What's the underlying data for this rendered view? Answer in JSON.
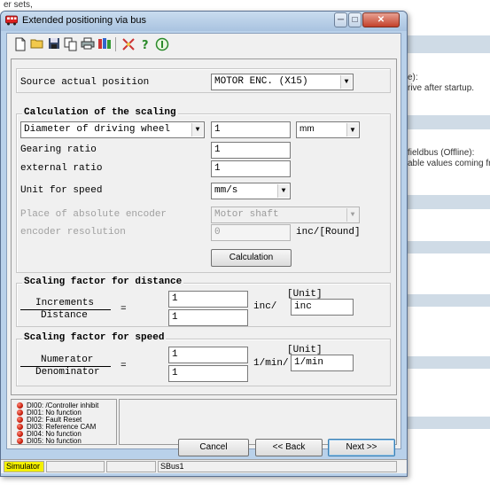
{
  "background": {
    "top_text": "er sets,",
    "side_lines": [
      "e):",
      "rive after startup.",
      "fieldbus (Offline):",
      "able values coming fr"
    ]
  },
  "window": {
    "title": "Extended positioning via bus",
    "min_glyph": "─",
    "max_glyph": "□",
    "close_glyph": "✕"
  },
  "toolbar": {
    "icons": [
      "new-document-icon",
      "open-folder-icon",
      "save-disk-icon",
      "copy-documents-icon",
      "print-icon",
      "books-icon",
      "tools-icon",
      "help-icon",
      "info-icon"
    ]
  },
  "source": {
    "label": "Source actual position",
    "value": "MOTOR ENC. (X15)"
  },
  "scaling": {
    "title": "Calculation of the scaling",
    "diameter_select": "Diameter of driving wheel",
    "diameter_value": "1",
    "diameter_unit": "mm",
    "gearing_label": "Gearing ratio",
    "gearing_value": "1",
    "external_label": "external ratio",
    "external_value": "1",
    "speed_unit_label": "Unit for speed",
    "speed_unit_value": "mm/s",
    "abs_encoder_label": "Place of absolute encoder",
    "abs_encoder_value": "Motor shaft",
    "encoder_res_label": "encoder resolution",
    "encoder_res_value": "0",
    "encoder_res_unit": "inc/[Round]",
    "calc_button": "Calculation"
  },
  "distance": {
    "title": "Scaling factor for distance",
    "numerator_label": "Increments",
    "denominator_label": "Distance",
    "equals": "=",
    "numerator_value": "1",
    "denominator_value": "1",
    "unit_prefix": "inc/",
    "unit_header": "[Unit]",
    "unit_value": "inc"
  },
  "speed": {
    "title": "Scaling factor for speed",
    "numerator_label": "Numerator",
    "denominator_label": "Denominator",
    "equals": "=",
    "numerator_value": "1",
    "denominator_value": "1",
    "unit_prefix": "1/min/",
    "unit_header": "[Unit]",
    "unit_value": "1/min"
  },
  "digital_inputs": [
    "DI00: /Controller inhibit",
    "DI01: No function",
    "DI02: Fault Reset",
    "DI03: Reference CAM",
    "DI04: No function",
    "DI05: No function"
  ],
  "buttons": {
    "cancel": "Cancel",
    "back": "<< Back",
    "next": "Next >>"
  },
  "status": {
    "mode": "Simulator",
    "bus": "SBus1"
  },
  "colors": {
    "led_red": "#c81d0b",
    "simulator_highlight": "#f4f000"
  }
}
